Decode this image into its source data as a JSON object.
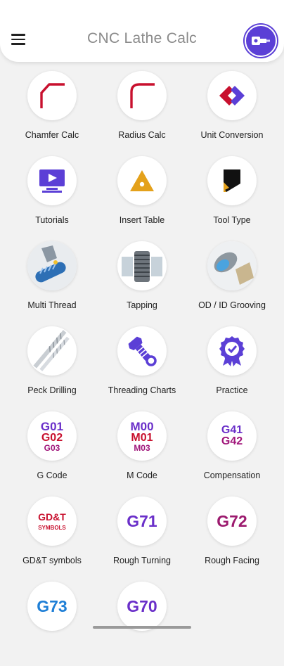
{
  "app": {
    "title": "CNC Lathe Calc",
    "accent_color": "#5b3fd6"
  },
  "appbar": {
    "menu_icon": "hamburger-menu-icon",
    "logo_icon": "lathe-logo-icon"
  },
  "tiles": [
    {
      "label": "Chamfer Calc",
      "icon": "chamfer-icon"
    },
    {
      "label": "Radius Calc",
      "icon": "radius-icon"
    },
    {
      "label": "Unit Conversion",
      "icon": "unit-conversion-arrows-icon"
    },
    {
      "label": "Tutorials",
      "icon": "video-monitor-icon"
    },
    {
      "label": "Insert Table",
      "icon": "triangle-insert-icon"
    },
    {
      "label": "Tool Type",
      "icon": "tool-insert-icon"
    },
    {
      "label": "Multi Thread",
      "icon": "multi-thread-photo-icon"
    },
    {
      "label": "Tapping",
      "icon": "tap-photo-icon"
    },
    {
      "label": "OD / ID Grooving",
      "icon": "grooving-photo-icon"
    },
    {
      "label": "Peck Drilling",
      "icon": "drill-bits-photo-icon"
    },
    {
      "label": "Threading Charts",
      "icon": "bolt-nut-icon"
    },
    {
      "label": "Practice",
      "icon": "award-badge-icon"
    },
    {
      "label": "G Code",
      "icon": "g-code-icon",
      "codes": [
        "G01",
        "G02",
        "G03"
      ]
    },
    {
      "label": "M Code",
      "icon": "m-code-icon",
      "codes": [
        "M00",
        "M01",
        "M03"
      ]
    },
    {
      "label": "Compensation",
      "icon": "compensation-icon",
      "codes": [
        "G41",
        "G42"
      ]
    },
    {
      "label": "GD&T symbols",
      "icon": "gdt-icon",
      "codes": [
        "GD&T",
        "SYMBOLS"
      ]
    },
    {
      "label": "Rough Turning",
      "icon": "g71-icon",
      "codes": [
        "G71"
      ]
    },
    {
      "label": "Rough Facing",
      "icon": "g72-icon",
      "codes": [
        "G72"
      ]
    },
    {
      "label": "",
      "icon": "g73-icon",
      "codes": [
        "G73"
      ]
    },
    {
      "label": "",
      "icon": "g70-icon",
      "codes": [
        "G70"
      ]
    }
  ]
}
